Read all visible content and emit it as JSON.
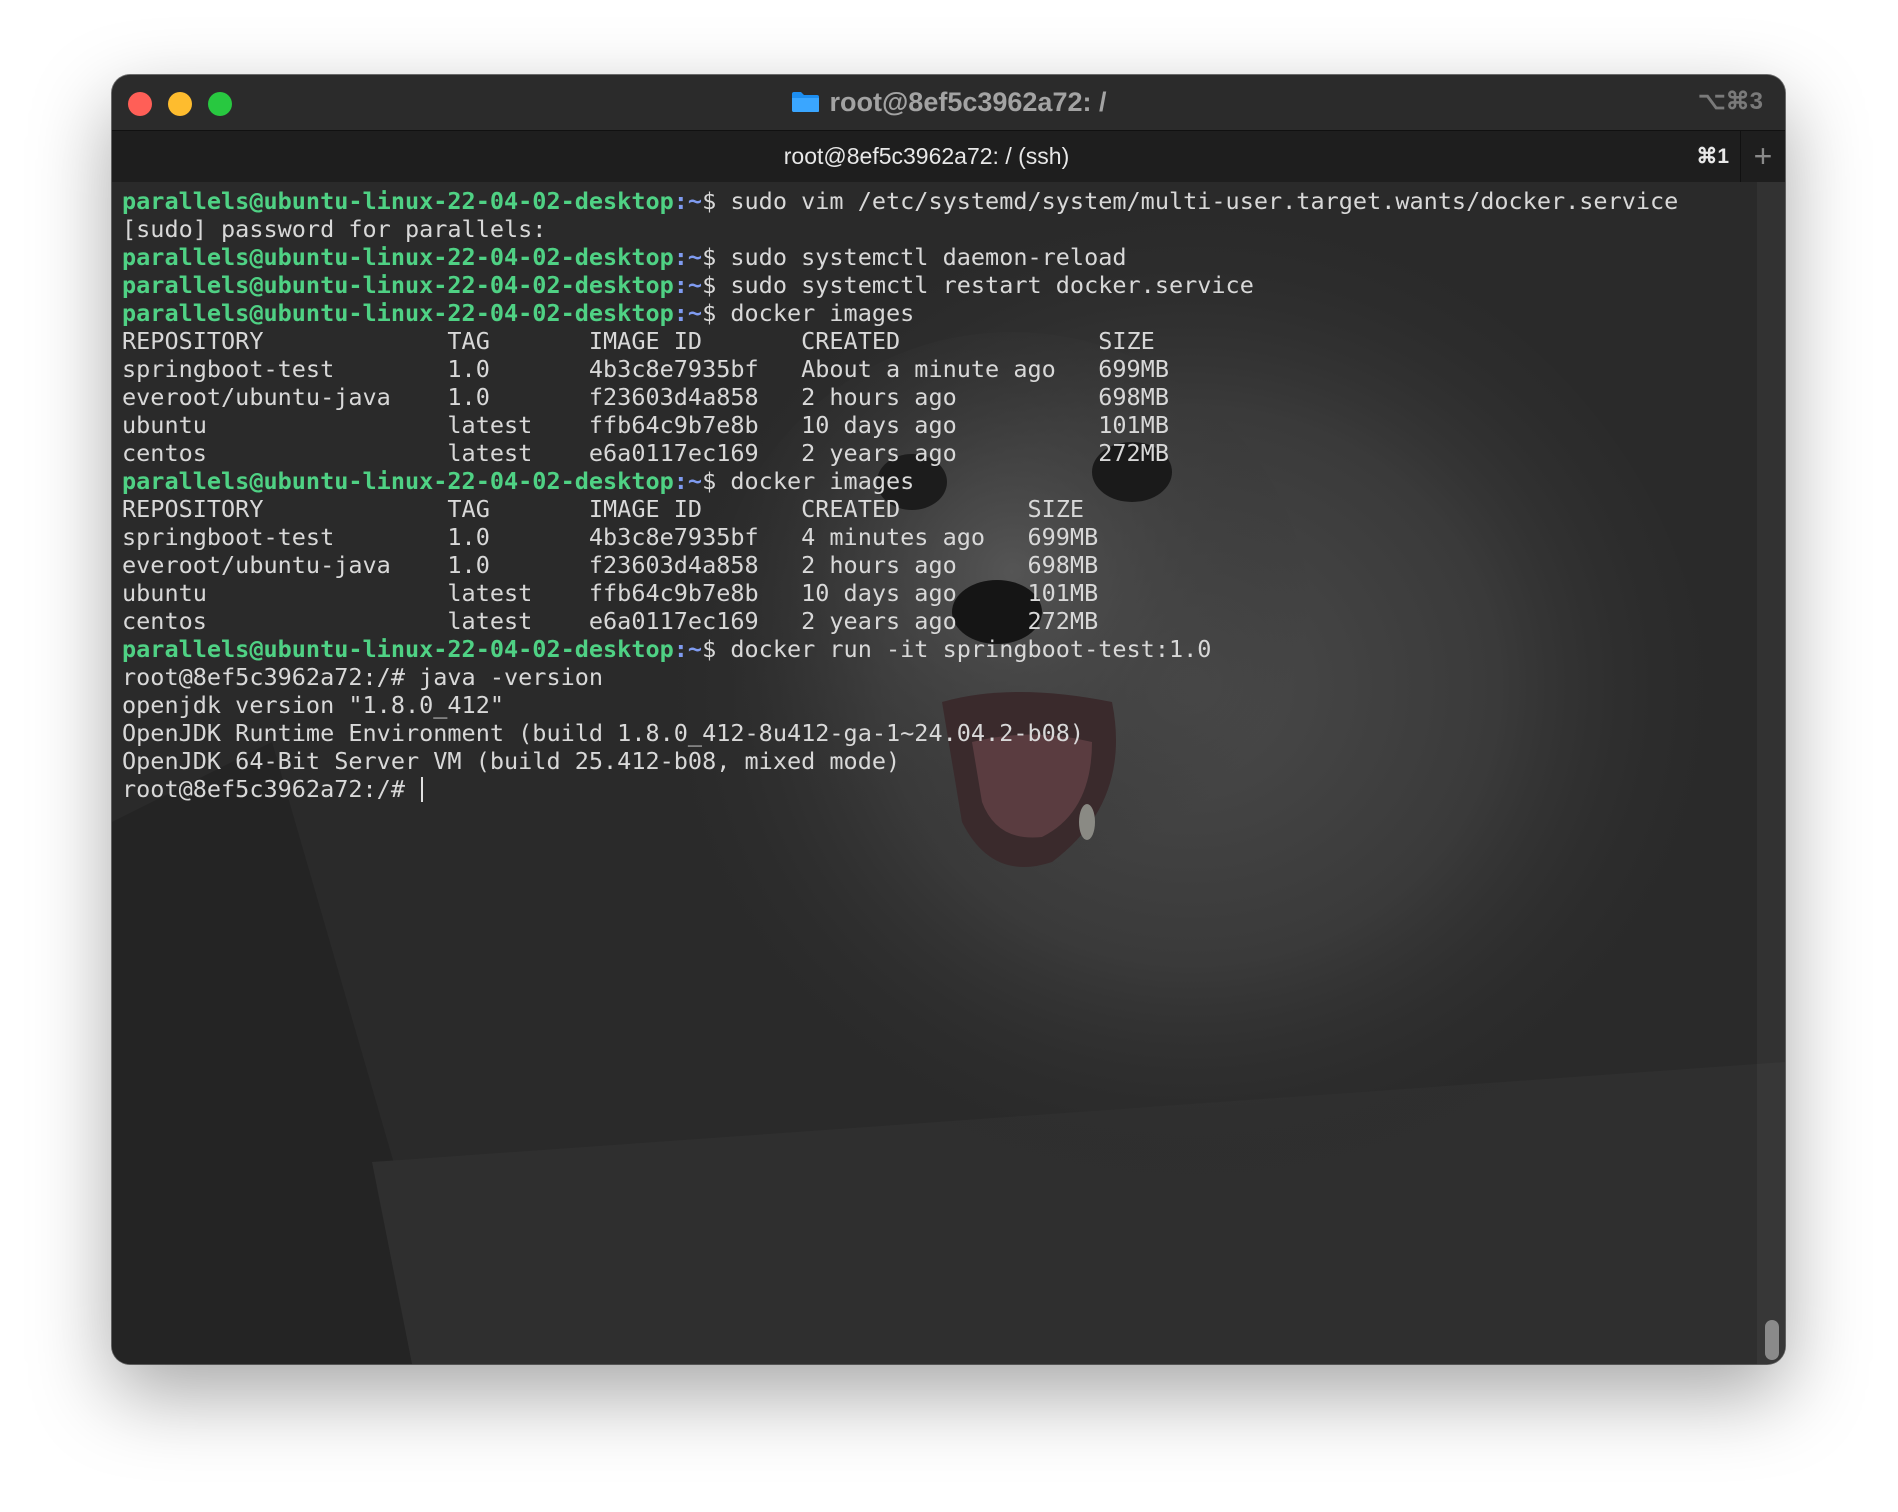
{
  "window": {
    "title": "root@8ef5c3962a72: /",
    "window_shortcut": "⌥⌘3"
  },
  "tab": {
    "label": "root@8ef5c3962a72: / (ssh)",
    "shortcut": "⌘1",
    "new_tab_symbol": "+"
  },
  "terminal": {
    "prompt_user": "parallels@ubuntu-linux-22-04-02-desktop",
    "prompt_path": ":~",
    "prompt_symbol": "$ ",
    "lines": [
      {
        "type": "cmd",
        "text": "sudo vim /etc/systemd/system/multi-user.target.wants/docker.service"
      },
      {
        "type": "out",
        "text": "[sudo] password for parallels:"
      },
      {
        "type": "cmd",
        "text": "sudo systemctl daemon-reload"
      },
      {
        "type": "cmd",
        "text": "sudo systemctl restart docker.service"
      },
      {
        "type": "cmd",
        "text": "docker images"
      },
      {
        "type": "out",
        "text": "REPOSITORY             TAG       IMAGE ID       CREATED              SIZE"
      },
      {
        "type": "out",
        "text": "springboot-test        1.0       4b3c8e7935bf   About a minute ago   699MB"
      },
      {
        "type": "out",
        "text": "everoot/ubuntu-java    1.0       f23603d4a858   2 hours ago          698MB"
      },
      {
        "type": "out",
        "text": "ubuntu                 latest    ffb64c9b7e8b   10 days ago          101MB"
      },
      {
        "type": "out",
        "text": "centos                 latest    e6a0117ec169   2 years ago          272MB"
      },
      {
        "type": "cmd",
        "text": "docker images"
      },
      {
        "type": "out",
        "text": "REPOSITORY             TAG       IMAGE ID       CREATED         SIZE"
      },
      {
        "type": "out",
        "text": "springboot-test        1.0       4b3c8e7935bf   4 minutes ago   699MB"
      },
      {
        "type": "out",
        "text": "everoot/ubuntu-java    1.0       f23603d4a858   2 hours ago     698MB"
      },
      {
        "type": "out",
        "text": "ubuntu                 latest    ffb64c9b7e8b   10 days ago     101MB"
      },
      {
        "type": "out",
        "text": "centos                 latest    e6a0117ec169   2 years ago     272MB"
      },
      {
        "type": "cmd",
        "text": "docker run -it springboot-test:1.0"
      },
      {
        "type": "out",
        "text": "root@8ef5c3962a72:/# java -version"
      },
      {
        "type": "out",
        "text": "openjdk version \"1.8.0_412\""
      },
      {
        "type": "out",
        "text": "OpenJDK Runtime Environment (build 1.8.0_412-8u412-ga-1~24.04.2-b08)"
      },
      {
        "type": "out",
        "text": "OpenJDK 64-Bit Server VM (build 25.412-b08, mixed mode)"
      },
      {
        "type": "cursor",
        "text": "root@8ef5c3962a72:/# "
      }
    ]
  }
}
